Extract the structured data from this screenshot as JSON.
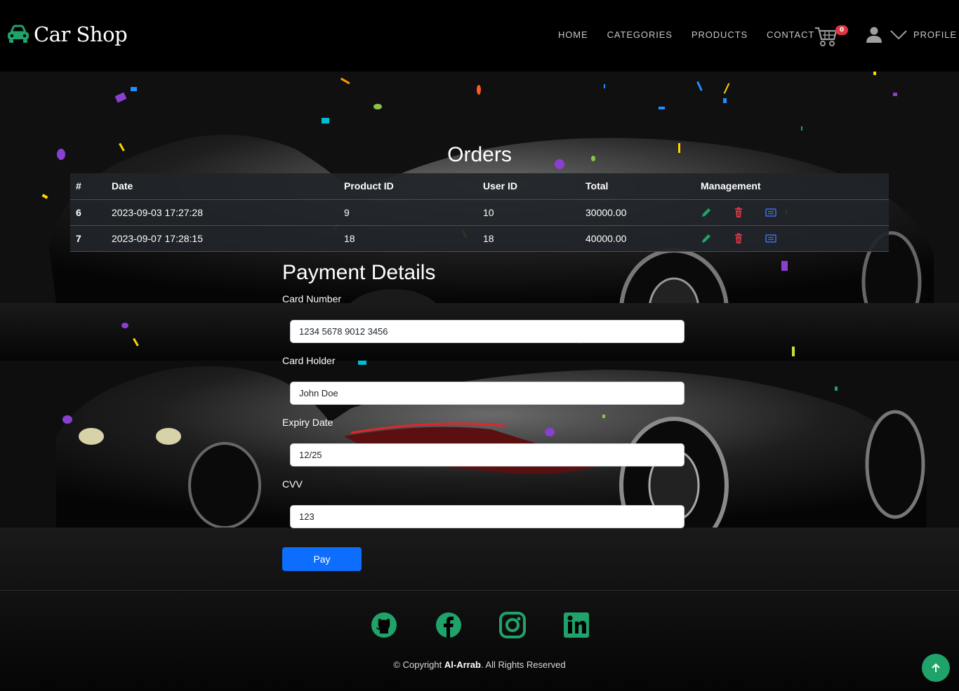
{
  "brand": {
    "name": "Car Shop",
    "icon": "car-icon"
  },
  "nav": {
    "links": [
      "HOME",
      "CATEGORIES",
      "PRODUCTS",
      "CONTACT"
    ],
    "cart_count": "0",
    "profile_label": "PROFILE"
  },
  "orders": {
    "title": "Orders",
    "headers": [
      "#",
      "Date",
      "Product ID",
      "User ID",
      "Total",
      "Management"
    ],
    "rows": [
      [
        "6",
        "2023-09-03 17:27:28",
        "9",
        "10",
        "30000.00"
      ],
      [
        "7",
        "2023-09-07 17:28:15",
        "18",
        "18",
        "40000.00"
      ]
    ],
    "actions": [
      "edit-icon",
      "delete-icon",
      "details-icon"
    ]
  },
  "payment": {
    "title": "Payment Details",
    "fields": [
      {
        "label": "Card Number",
        "value": "1234 5678 9012 3456"
      },
      {
        "label": "Card Holder",
        "value": "John Doe"
      },
      {
        "label": "Expiry Date",
        "value": "12/25"
      },
      {
        "label": "CVV",
        "value": "123"
      }
    ],
    "pay_label": "Pay"
  },
  "footer": {
    "social_icons": [
      "github-icon",
      "facebook-icon",
      "instagram-icon",
      "linkedin-icon"
    ],
    "copyright_prefix": "© Copyright ",
    "copyright_name": "Al-Arrab",
    "copyright_suffix": ". All Rights Reserved"
  },
  "colors": {
    "accent": "#1fa36a",
    "primary": "#0d6efd",
    "danger": "#dc3545",
    "edit": "#1fa36a",
    "info": "#3f6fe6"
  }
}
